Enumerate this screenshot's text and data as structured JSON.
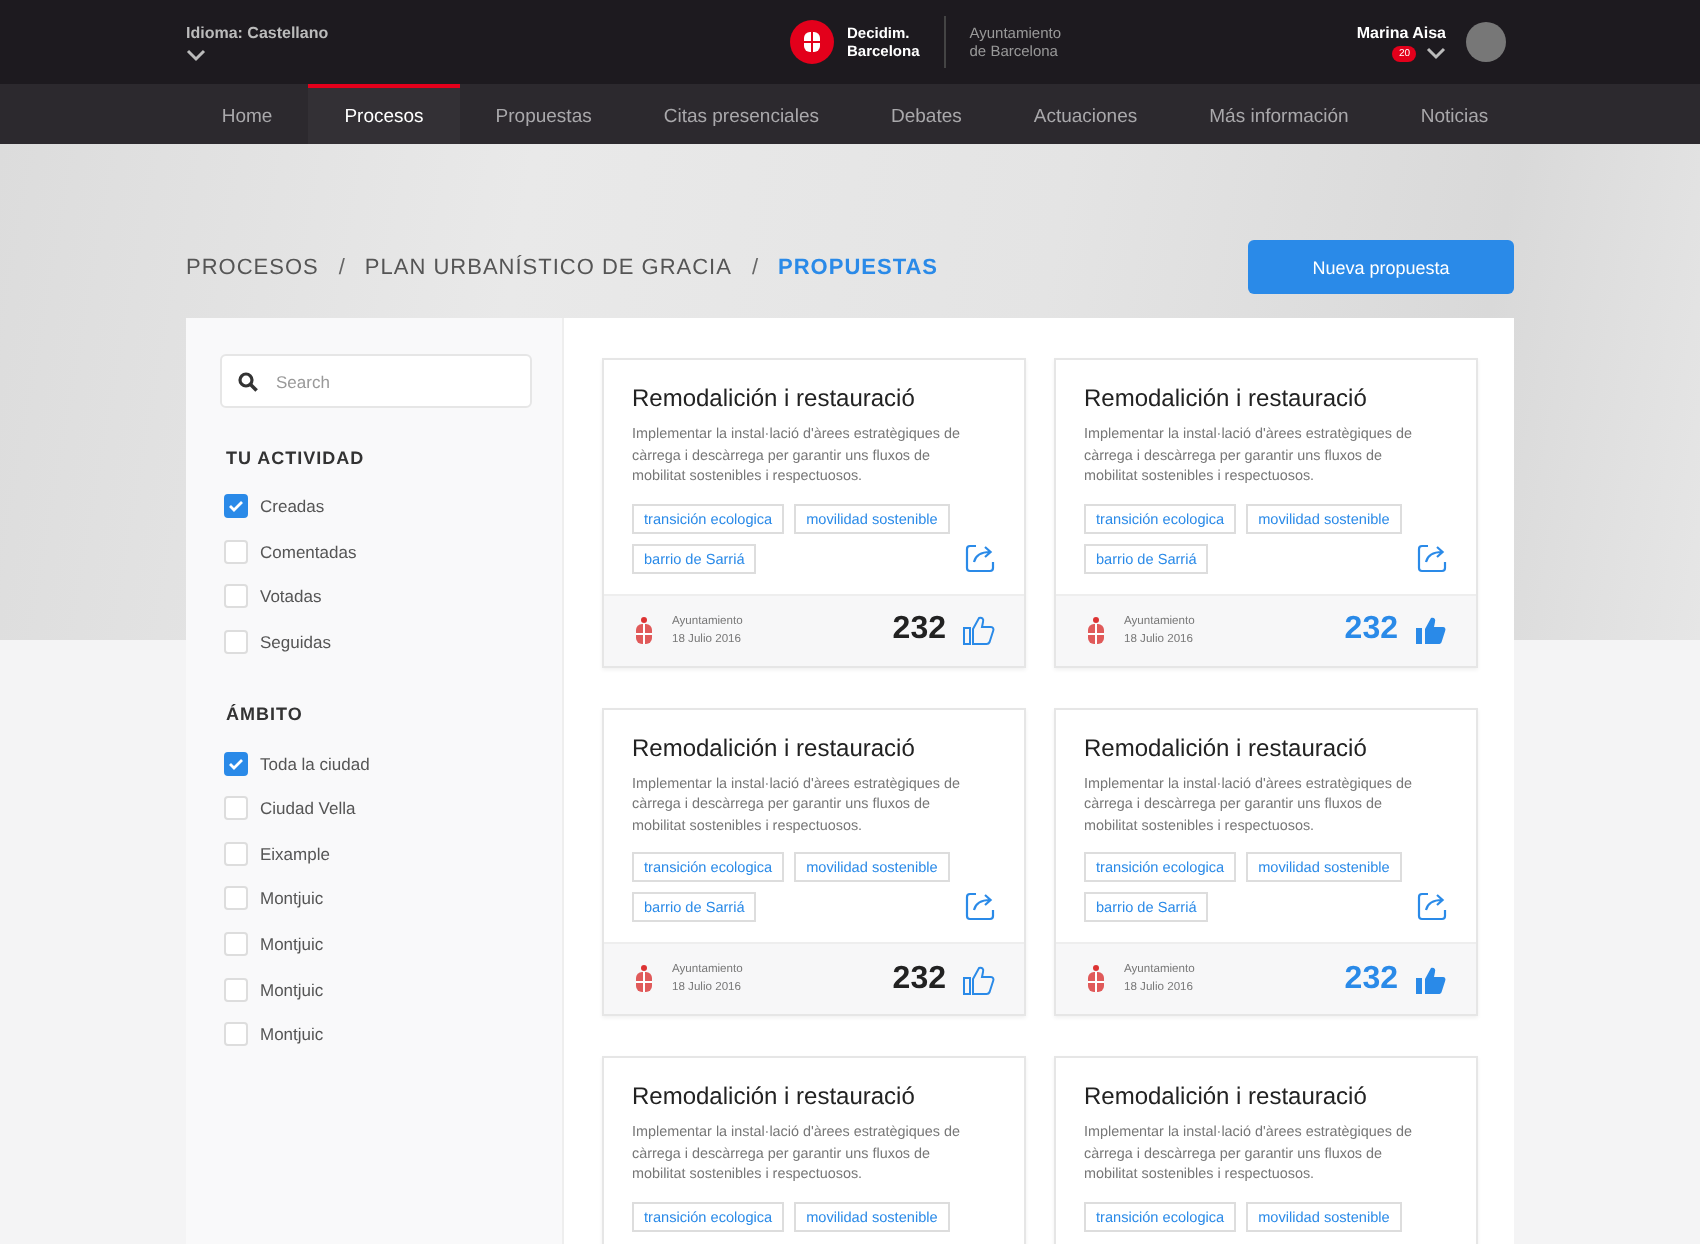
{
  "header": {
    "language": "Idioma: Castellano",
    "brand": [
      "Decidim.",
      "Barcelona"
    ],
    "org": [
      "Ayuntamiento",
      "de Barcelona"
    ],
    "user": {
      "name": "Marina Aisa",
      "notifications": "20"
    }
  },
  "nav": [
    {
      "label": "Home",
      "selected": false
    },
    {
      "label": "Procesos",
      "selected": true
    },
    {
      "label": "Propuestas",
      "selected": false
    },
    {
      "label": "Citas presenciales",
      "selected": false
    },
    {
      "label": "Debates",
      "selected": false
    },
    {
      "label": "Actuaciones",
      "selected": false
    },
    {
      "label": "Más información",
      "selected": false
    },
    {
      "label": "Noticias",
      "selected": false
    }
  ],
  "breadcrumb": [
    {
      "label": "PROCESOS",
      "selected": false
    },
    {
      "label": "PLAN URBANÍSTICO DE GRACIA",
      "selected": false
    },
    {
      "label": "PROPUESTAS",
      "selected": true
    }
  ],
  "breadcrumb_separator": "/",
  "new_button": "Nueva propuesta",
  "sidebar": {
    "search": {
      "placeholder": "Search"
    },
    "groups": [
      {
        "title": "TU ACTIVIDAD",
        "items": [
          {
            "label": "Creadas",
            "checked": true
          },
          {
            "label": "Comentadas",
            "checked": false
          },
          {
            "label": "Votadas",
            "checked": false
          },
          {
            "label": "Seguidas",
            "checked": false
          }
        ]
      },
      {
        "title": "ÁMBITO",
        "items": [
          {
            "label": "Toda la ciudad",
            "checked": true
          },
          {
            "label": "Ciudad Vella",
            "checked": false
          },
          {
            "label": "Eixample",
            "checked": false
          },
          {
            "label": "Montjuic",
            "checked": false
          },
          {
            "label": "Montjuic",
            "checked": false
          },
          {
            "label": "Montjuic",
            "checked": false
          },
          {
            "label": "Montjuic",
            "checked": false
          }
        ]
      }
    ]
  },
  "cards": [
    {
      "title": "Remodalición i restauració",
      "description": "Implementar la instal·lació d'àrees estratègiques de càrrega i descàrrega per garantir uns fluxos de mobilitat sostenibles i respectuosos.",
      "tags": [
        "transición ecologica",
        "movilidad sostenible",
        "barrio de Sarriá"
      ],
      "author": "Ayuntamiento",
      "date": "18 Julio 2016",
      "votes": "232",
      "voted": false
    },
    {
      "title": "Remodalición i restauració",
      "description": "Implementar la instal·lació d'àrees estratègiques de càrrega i descàrrega per garantir uns fluxos de mobilitat sostenibles i respectuosos.",
      "tags": [
        "transición ecologica",
        "movilidad sostenible",
        "barrio de Sarriá"
      ],
      "author": "Ayuntamiento",
      "date": "18 Julio 2016",
      "votes": "232",
      "voted": true
    },
    {
      "title": "Remodalición i restauració",
      "description": "Implementar la instal·lació d'àrees estratègiques de càrrega i descàrrega per garantir uns fluxos de mobilitat sostenibles i respectuosos.",
      "tags": [
        "transición ecologica",
        "movilidad sostenible",
        "barrio de Sarriá"
      ],
      "author": "Ayuntamiento",
      "date": "18 Julio 2016",
      "votes": "232",
      "voted": false
    },
    {
      "title": "Remodalición i restauració",
      "description": "Implementar la instal·lació d'àrees estratègiques de càrrega i descàrrega per garantir uns fluxos de mobilitat sostenibles i respectuosos.",
      "tags": [
        "transición ecologica",
        "movilidad sostenible",
        "barrio de Sarriá"
      ],
      "author": "Ayuntamiento",
      "date": "18 Julio 2016",
      "votes": "232",
      "voted": true
    },
    {
      "title": "Remodalición i restauració",
      "description": "Implementar la instal·lació d'àrees estratègiques de càrrega i descàrrega per garantir uns fluxos de mobilitat sostenibles i respectuosos.",
      "tags": [
        "transición ecologica",
        "movilidad sostenible"
      ]
    },
    {
      "title": "Remodalición i restauració",
      "description": "Implementar la instal·lació d'àrees estratègiques de càrrega i descàrrega per garantir uns fluxos de mobilitat sostenibles i respectuosos.",
      "tags": [
        "transición ecologica",
        "movilidad sostenible"
      ]
    }
  ]
}
